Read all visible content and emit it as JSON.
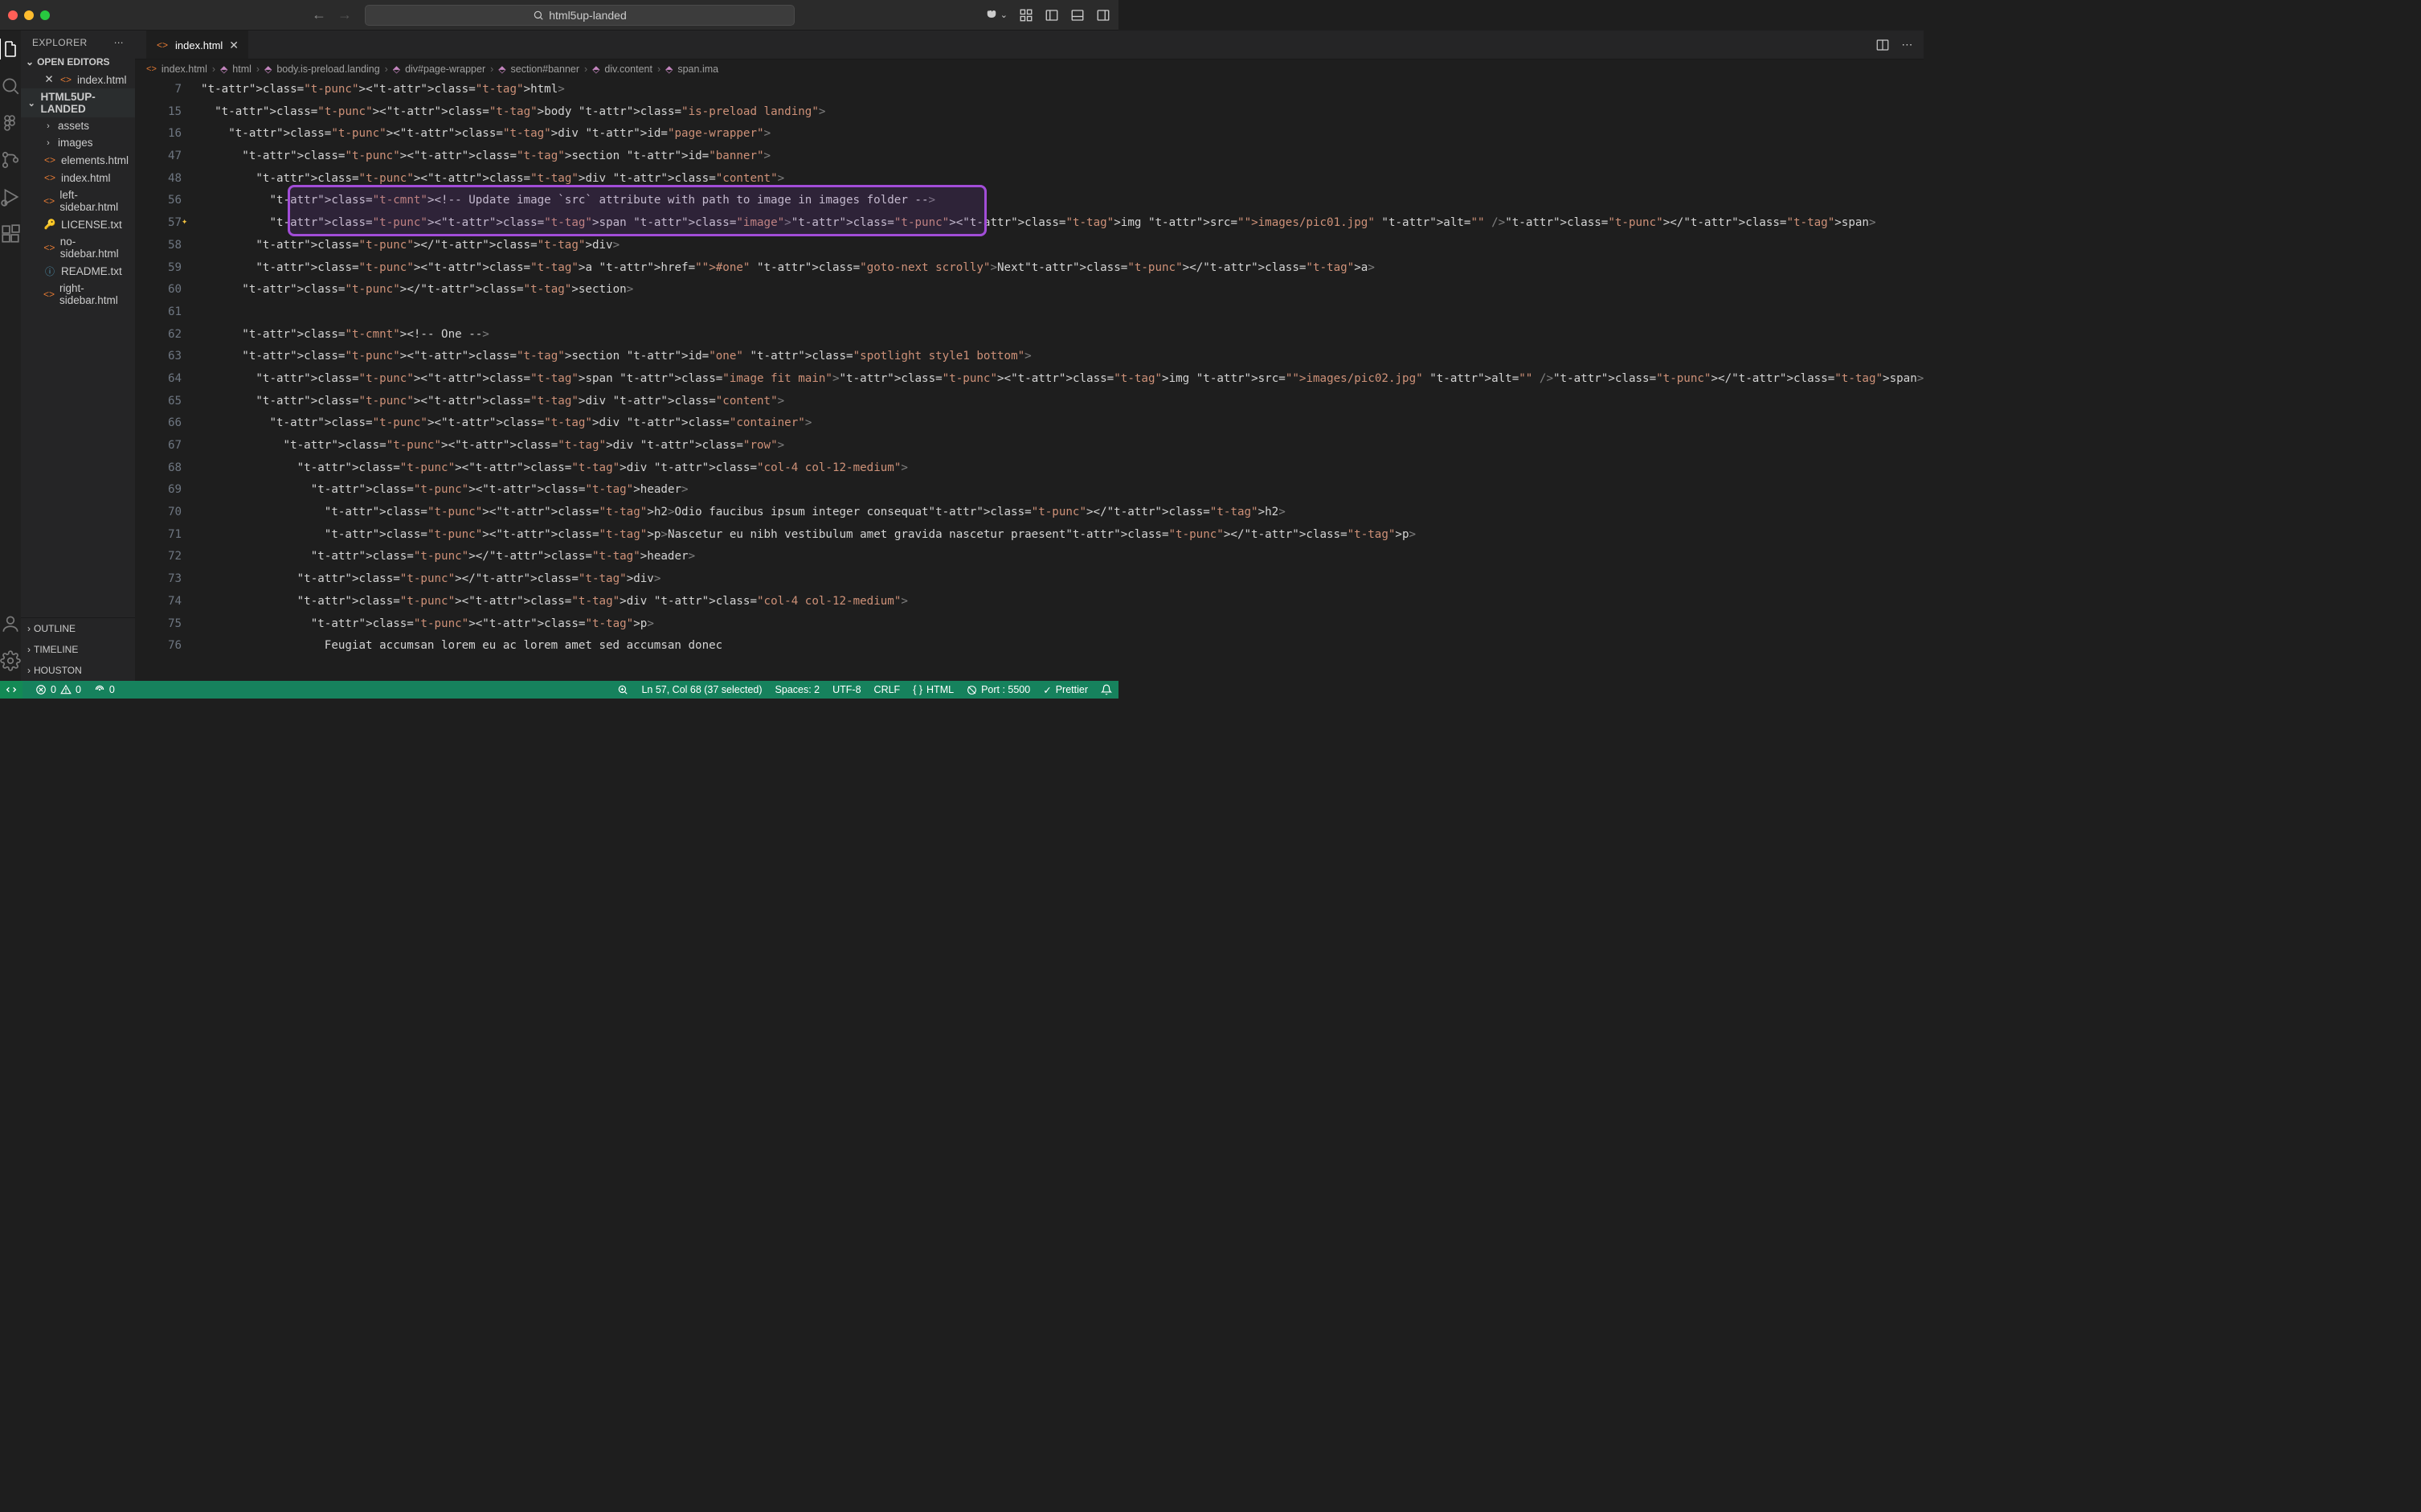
{
  "title": "html5up-landed",
  "search_placeholder": "html5up-landed",
  "explorer_label": "EXPLORER",
  "open_editors_label": "OPEN EDITORS",
  "open_file": "index.html",
  "project_label": "HTML5UP-LANDED",
  "tree": {
    "folder_assets": "assets",
    "folder_images": "images",
    "f_elements": "elements.html",
    "f_index": "index.html",
    "f_leftsidebar": "left-sidebar.html",
    "f_license": "LICENSE.txt",
    "f_nosidebar": "no-sidebar.html",
    "f_readme": "README.txt",
    "f_rightsidebar": "right-sidebar.html"
  },
  "panels": {
    "outline": "OUTLINE",
    "timeline": "TIMELINE",
    "houston": "HOUSTON"
  },
  "tab_file": "index.html",
  "breadcrumb": {
    "b0": "index.html",
    "b1": "html",
    "b2": "body.is-preload.landing",
    "b3": "div#page-wrapper",
    "b4": "section#banner",
    "b5": "div.content",
    "b6": "span.ima"
  },
  "lines": [
    "7",
    "15",
    "16",
    "47",
    "48",
    "56",
    "57",
    "58",
    "59",
    "60",
    "61",
    "62",
    "63",
    "64",
    "65",
    "66",
    "67",
    "68",
    "69",
    "70",
    "71",
    "72",
    "73",
    "74",
    "75",
    "76"
  ],
  "code": {
    "l7": "<html>",
    "l15": "  <body class=\"is-preload landing\">",
    "l16": "    <div id=\"page-wrapper\">",
    "l47": "      <section id=\"banner\">",
    "l48": "        <div class=\"content\">",
    "l56": "          <!-- Update image `src` attribute with path to image in images folder -->",
    "l57": "          <span class=\"image\"><img src=\"images/pic01.jpg\" alt=\"\" /></span>",
    "l58": "        </div>",
    "l59": "        <a href=\"#one\" class=\"goto-next scrolly\">Next</a>",
    "l60": "      </section>",
    "l61": "",
    "l62": "      <!-- One -->",
    "l63": "      <section id=\"one\" class=\"spotlight style1 bottom\">",
    "l64": "        <span class=\"image fit main\"><img src=\"images/pic02.jpg\" alt=\"\" /></span>",
    "l65": "        <div class=\"content\">",
    "l66": "          <div class=\"container\">",
    "l67": "            <div class=\"row\">",
    "l68": "              <div class=\"col-4 col-12-medium\">",
    "l69": "                <header>",
    "l70": "                  <h2>Odio faucibus ipsum integer consequat</h2>",
    "l71": "                  <p>Nascetur eu nibh vestibulum amet gravida nascetur praesent</p>",
    "l72": "                </header>",
    "l73": "              </div>",
    "l74": "              <div class=\"col-4 col-12-medium\">",
    "l75": "                <p>",
    "l76": "                  Feugiat accumsan lorem eu ac lorem amet sed accumsan donec"
  },
  "status": {
    "errors": "0",
    "warnings": "0",
    "ports": "0",
    "cursor": "Ln 57, Col 68 (37 selected)",
    "spaces": "Spaces: 2",
    "encoding": "UTF-8",
    "eol": "CRLF",
    "lang": "HTML",
    "port": "Port : 5500",
    "prettier": "Prettier"
  }
}
